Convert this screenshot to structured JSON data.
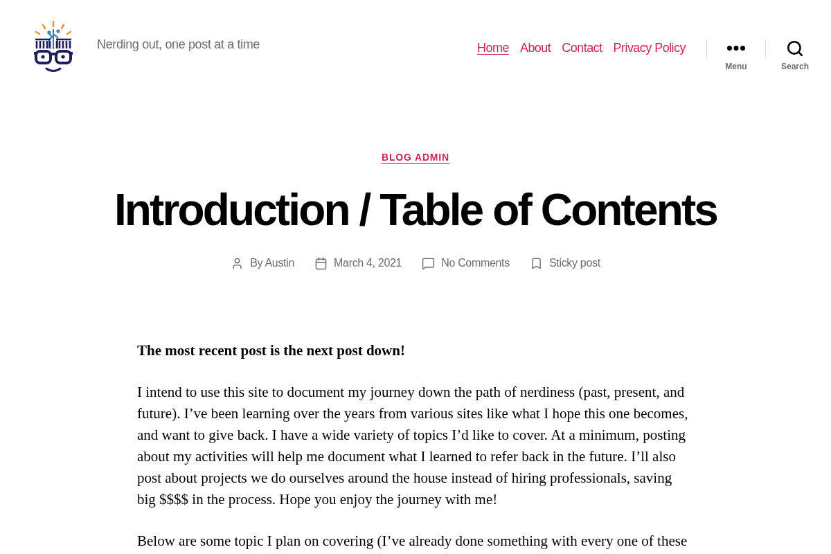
{
  "header": {
    "tagline": "Nerding out, one post at a time",
    "nav": [
      {
        "label": "Home",
        "selected": true
      },
      {
        "label": "About",
        "selected": false
      },
      {
        "label": "Contact",
        "selected": false
      },
      {
        "label": "Privacy Policy",
        "selected": false
      }
    ],
    "toggles": [
      {
        "kind": "menu",
        "label": "Menu"
      },
      {
        "kind": "search",
        "label": "Search"
      }
    ]
  },
  "post": {
    "category": "BLOG ADMIN",
    "title": "Introduction / Table of Contents",
    "meta": [
      {
        "kind": "author",
        "text": "By Austin"
      },
      {
        "kind": "date",
        "text": "March 4, 2021"
      },
      {
        "kind": "comments",
        "text": "No Comments"
      },
      {
        "kind": "sticky",
        "text": "Sticky post"
      }
    ],
    "paragraphs": [
      {
        "kind": "bold",
        "text": "The most recent post is the next post down!"
      },
      {
        "kind": "plain",
        "text": "I intend to use this site to document my journey down the path of nerdiness (past, present, and future). I’ve been learning over the years from various sites like what I hope this one becomes, and want to give back. I have a wide variety of topics I’d like to cover. At a minimum, posting about my activities will help me document what I learned to refer back in the future. I’ll also post about projects we do ourselves around the house instead of hiring professionals, saving big $$$$ in the process. Hope you enjoy the journey with me!"
      },
      {
        "kind": "plain",
        "text": "Below are some topic I plan on covering (I’ve already done something with every one of these"
      }
    ]
  }
}
